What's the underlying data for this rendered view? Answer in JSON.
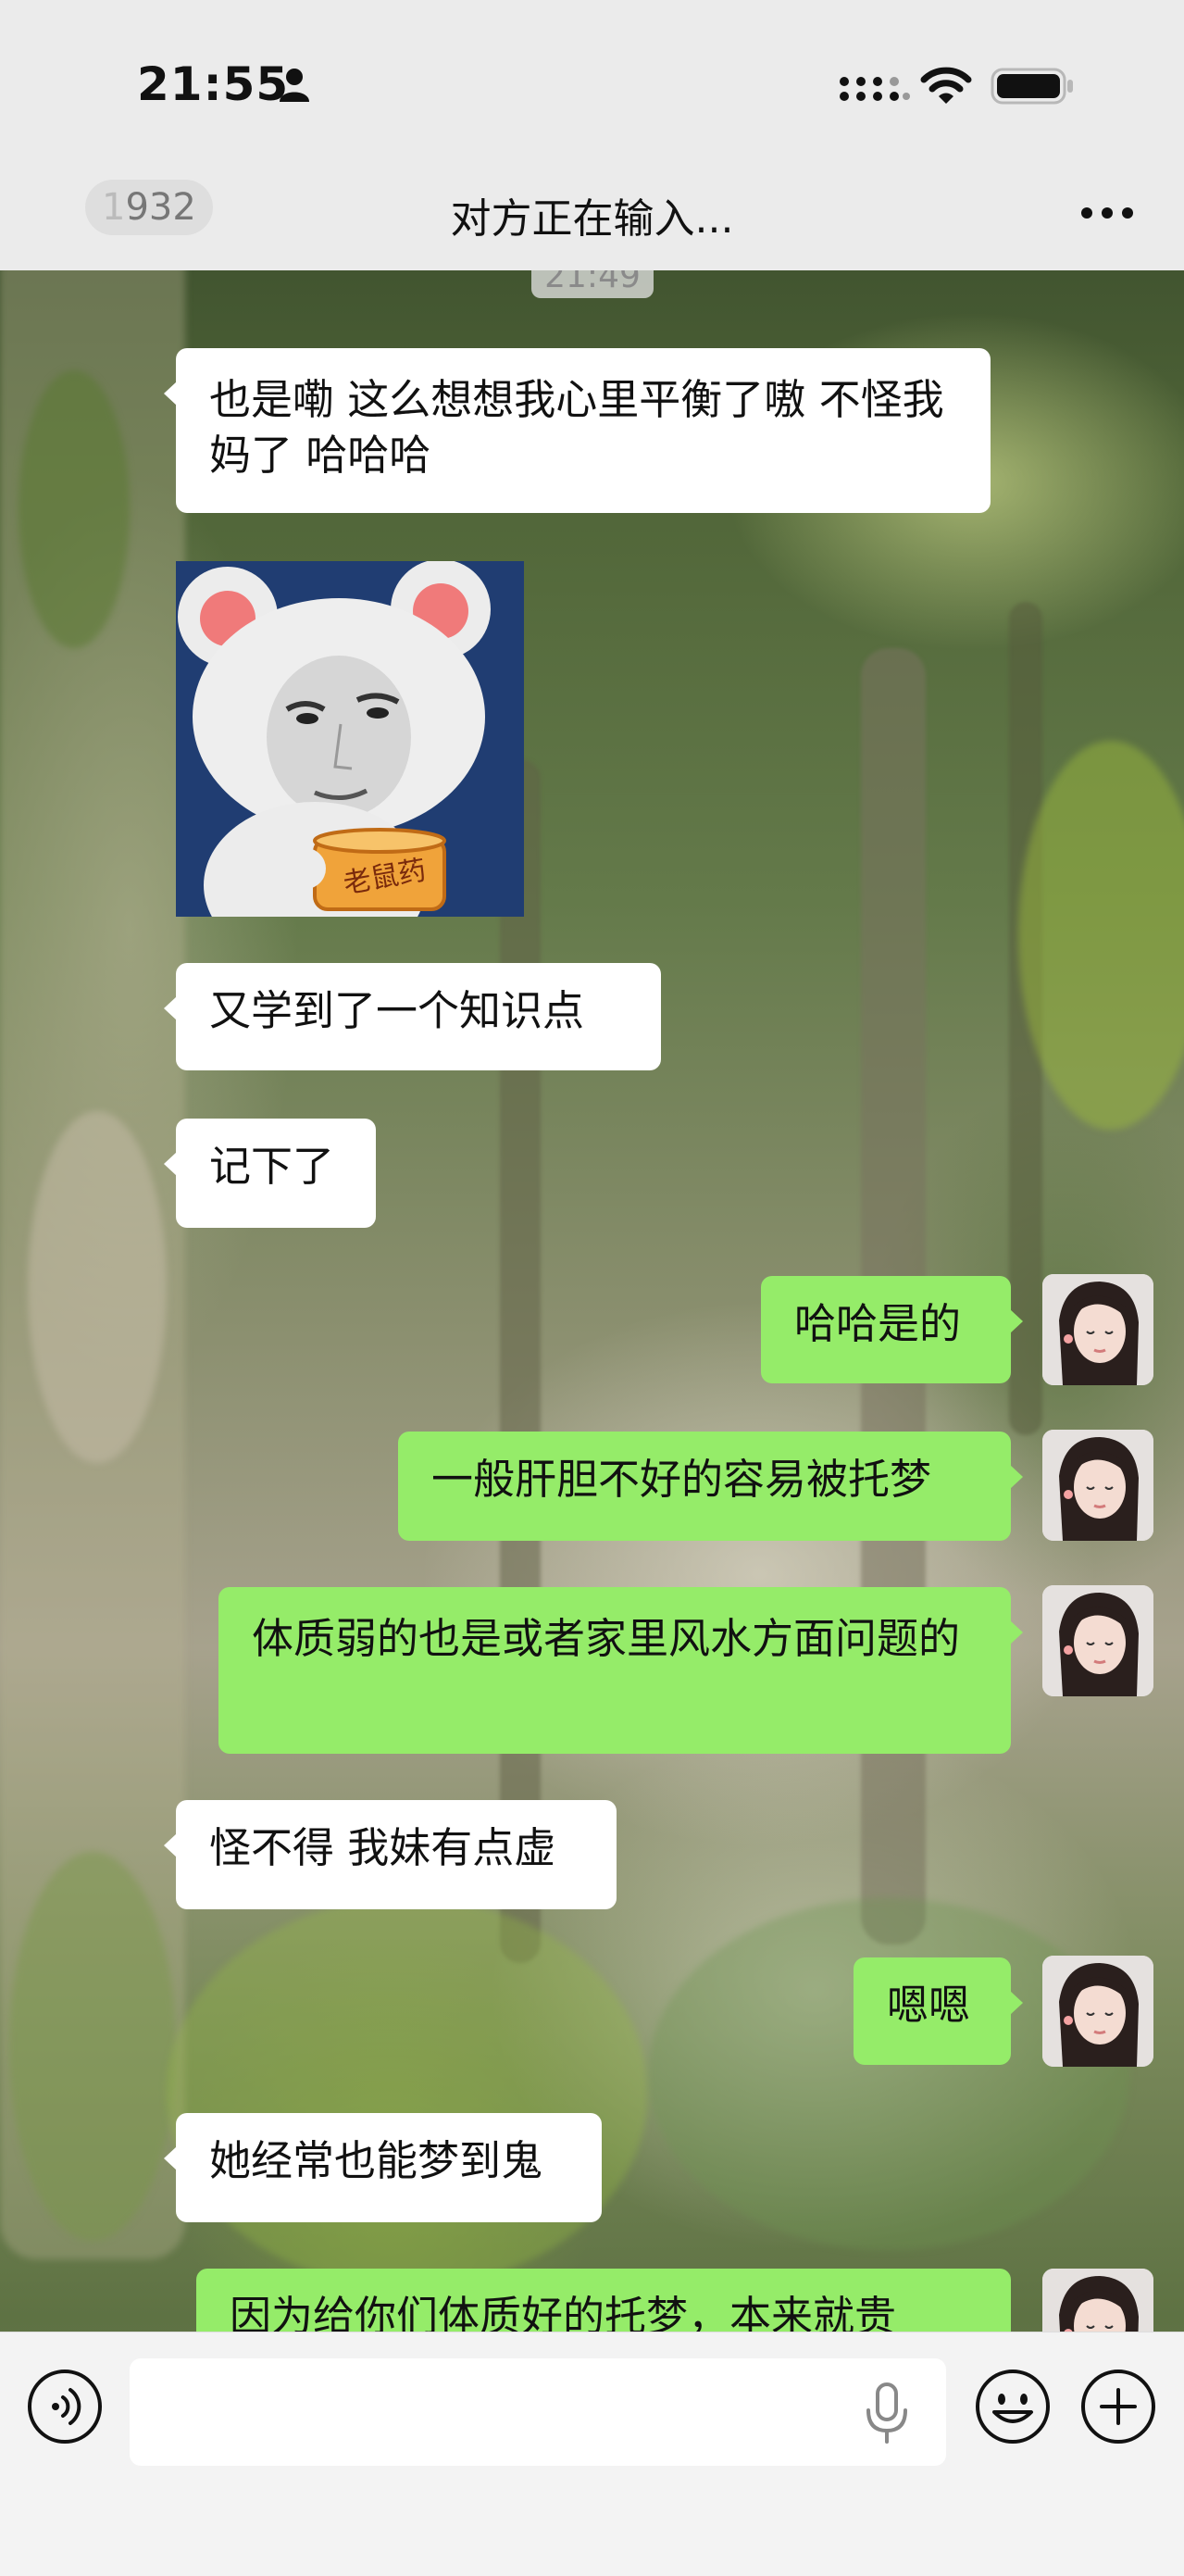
{
  "status_bar": {
    "time": "21:55",
    "icons": [
      "person-icon",
      "signal-icon",
      "wifi-icon",
      "battery-icon"
    ]
  },
  "nav": {
    "back_badge_prefix": "1",
    "back_badge_value": "932",
    "title": "对方正在输入...",
    "more_icon": "more-icon"
  },
  "chat": {
    "timestamp": "21:49",
    "messages": [
      {
        "side": "in",
        "type": "text",
        "text": "也是嘞 这么想想我心里平衡了嗷 不怪我妈了 哈哈哈"
      },
      {
        "side": "in",
        "type": "sticker",
        "text": "老鼠药"
      },
      {
        "side": "in",
        "type": "text",
        "text": "又学到了一个知识点"
      },
      {
        "side": "in",
        "type": "text",
        "text": "记下了"
      },
      {
        "side": "out",
        "type": "text",
        "text": "哈哈是的"
      },
      {
        "side": "out",
        "type": "text",
        "text": "一般肝胆不好的容易被托梦"
      },
      {
        "side": "out",
        "type": "text",
        "text": "体质弱的也是或者家里风水方面问题的"
      },
      {
        "side": "in",
        "type": "text",
        "text": "怪不得 我妹有点虚"
      },
      {
        "side": "out",
        "type": "text",
        "text": "嗯嗯"
      },
      {
        "side": "in",
        "type": "text",
        "text": "她经常也能梦到鬼"
      },
      {
        "side": "out",
        "type": "text",
        "text": "因为给你们体质好的托梦，本来就贵"
      }
    ]
  },
  "input_bar": {
    "value": "",
    "placeholder": "",
    "icons": [
      "voice-icon",
      "mic-icon",
      "emoji-icon",
      "plus-icon"
    ]
  },
  "colors": {
    "bar_bg": "#ebebeb",
    "incoming_bubble": "#ffffff",
    "outgoing_bubble": "#95ec69"
  }
}
